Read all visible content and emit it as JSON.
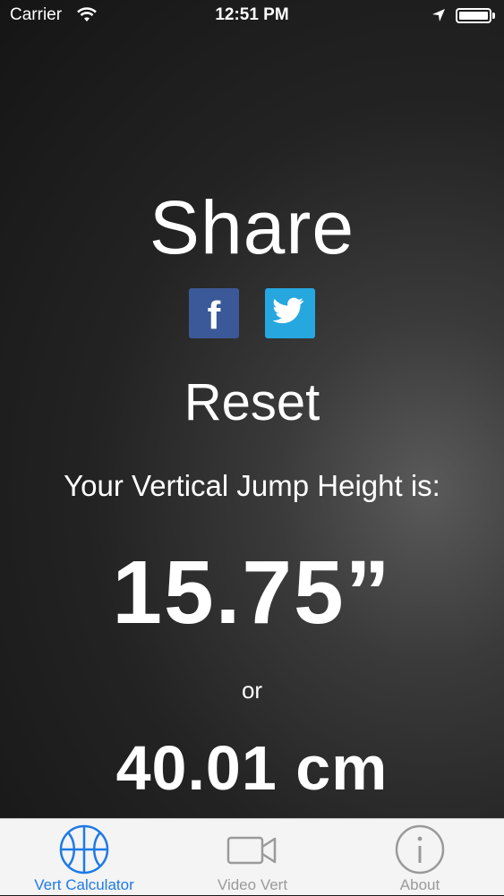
{
  "status_bar": {
    "carrier": "Carrier",
    "time": "12:51 PM"
  },
  "main": {
    "share_title": "Share",
    "social": [
      {
        "name": "facebook",
        "glyph": "f"
      },
      {
        "name": "twitter"
      }
    ],
    "reset_label": "Reset",
    "result_label": "Your Vertical Jump Height is:",
    "height_inches": "15.75”",
    "or_label": "or",
    "height_cm": "40.01 cm"
  },
  "tabs": [
    {
      "label": "Vert Calculator",
      "icon": "basketball-icon",
      "active": true
    },
    {
      "label": "Video Vert",
      "icon": "video-camera-icon",
      "active": false
    },
    {
      "label": "About",
      "icon": "info-icon",
      "active": false
    }
  ],
  "colors": {
    "accent": "#1e7ae6",
    "facebook": "#3b5998",
    "twitter": "#26a7e0"
  }
}
